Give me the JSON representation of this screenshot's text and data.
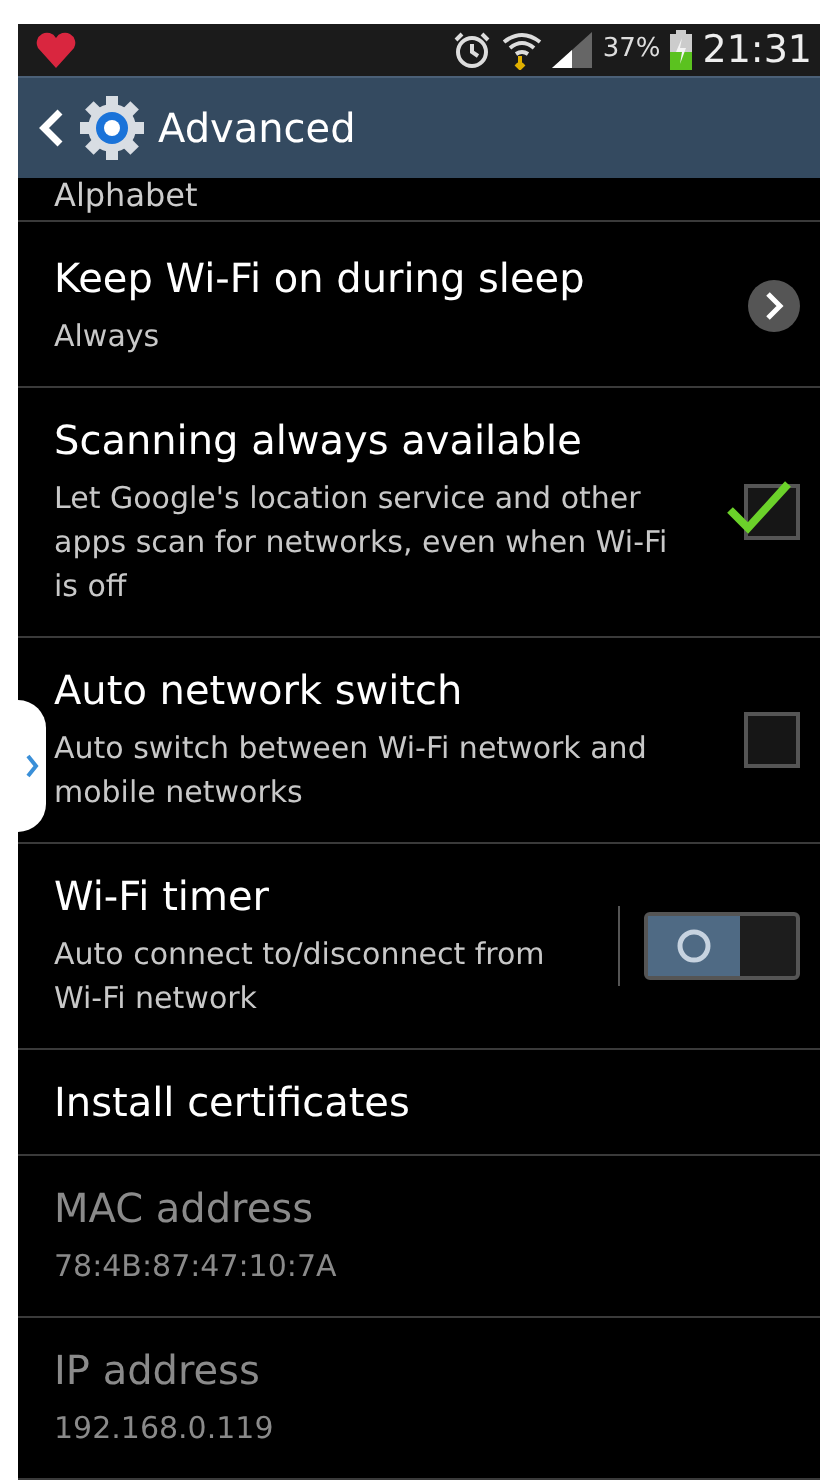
{
  "status_bar": {
    "battery_percent": "37%",
    "time": "21:31"
  },
  "action_bar": {
    "title": "Advanced"
  },
  "cut_item": {
    "summary": "Alphabet"
  },
  "items": [
    {
      "kind": "link",
      "title": "Keep Wi-Fi on during sleep",
      "summary": "Always",
      "disabled": false
    },
    {
      "kind": "checkbox",
      "title": "Scanning always available",
      "summary": "Let Google's location service and other apps scan for networks, even when Wi-Fi is off",
      "checked": true,
      "disabled": false
    },
    {
      "kind": "checkbox",
      "title": "Auto network switch",
      "summary": "Auto switch between Wi-Fi network and mobile networks",
      "checked": false,
      "disabled": false
    },
    {
      "kind": "switch",
      "title": "Wi-Fi timer",
      "summary": "Auto connect to/disconnect from Wi-Fi network",
      "on": false,
      "disabled": false
    },
    {
      "kind": "plain",
      "title": "Install certificates",
      "disabled": false
    },
    {
      "kind": "plain",
      "title": "MAC address",
      "summary": "78:4B:87:47:10:7A",
      "disabled": true
    },
    {
      "kind": "plain",
      "title": "IP address",
      "summary": "192.168.0.119",
      "disabled": true
    }
  ]
}
